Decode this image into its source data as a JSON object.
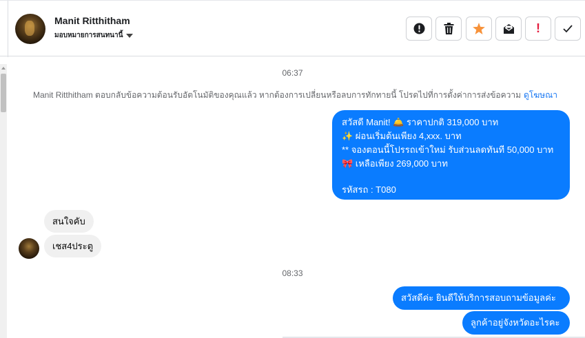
{
  "header": {
    "contact_name": "Manit Ritthitham",
    "assign_label": "มอบหมายการสนทนานี้",
    "toolbar": [
      {
        "name": "mark-spam-button",
        "icon": "alert-circle-icon"
      },
      {
        "name": "delete-button",
        "icon": "trash-icon"
      },
      {
        "name": "star-button",
        "icon": "star-icon",
        "color": "#f7923a"
      },
      {
        "name": "mark-unread-button",
        "icon": "envelope-icon"
      },
      {
        "name": "mark-important-button",
        "icon": "exclamation-icon",
        "color": "#e41e3f"
      },
      {
        "name": "mark-done-button",
        "icon": "check-icon"
      }
    ]
  },
  "conversation": {
    "time_1": "06:37",
    "notice_text": "Manit Ritthitham ตอบกลับข้อความต้อนรับอัตโนมัติของคุณแล้ว หากต้องการเปลี่ยนหรือลบการทักทายนี้ โปรดไปที่การตั้งค่าการส่งข้อความ",
    "notice_link": "ดูโฆษณา",
    "outgoing_1": {
      "line1": "สวัสดี Manit! 🛎️  ราคาปกติ  319,000 บาท",
      "line2": "✨  ผ่อนเริ่มต้นเพียง 4,xxx. บาท",
      "line3": "** จองตอนนี้โปรรถเข้าใหม่ รับส่วนลดทันที 50,000 บาท",
      "line4": "🎀  เหลือเพียง 269,000 บาท",
      "line5": "รหัสรถ : T080"
    },
    "incoming_1": "สนใจคับ",
    "incoming_2": "เชส4ประตู",
    "time_2": "08:33",
    "outgoing_2": "สวัสดีค่ะ  ยินดีให้บริการสอบถามข้อมูลค่ะ",
    "outgoing_3": "ลูกค้าอยู่จังหวัดอะไรคะ"
  },
  "colors": {
    "outgoing_bubble": "#0a7cff",
    "incoming_bubble": "#f0f0f0",
    "link": "#1877f2"
  }
}
